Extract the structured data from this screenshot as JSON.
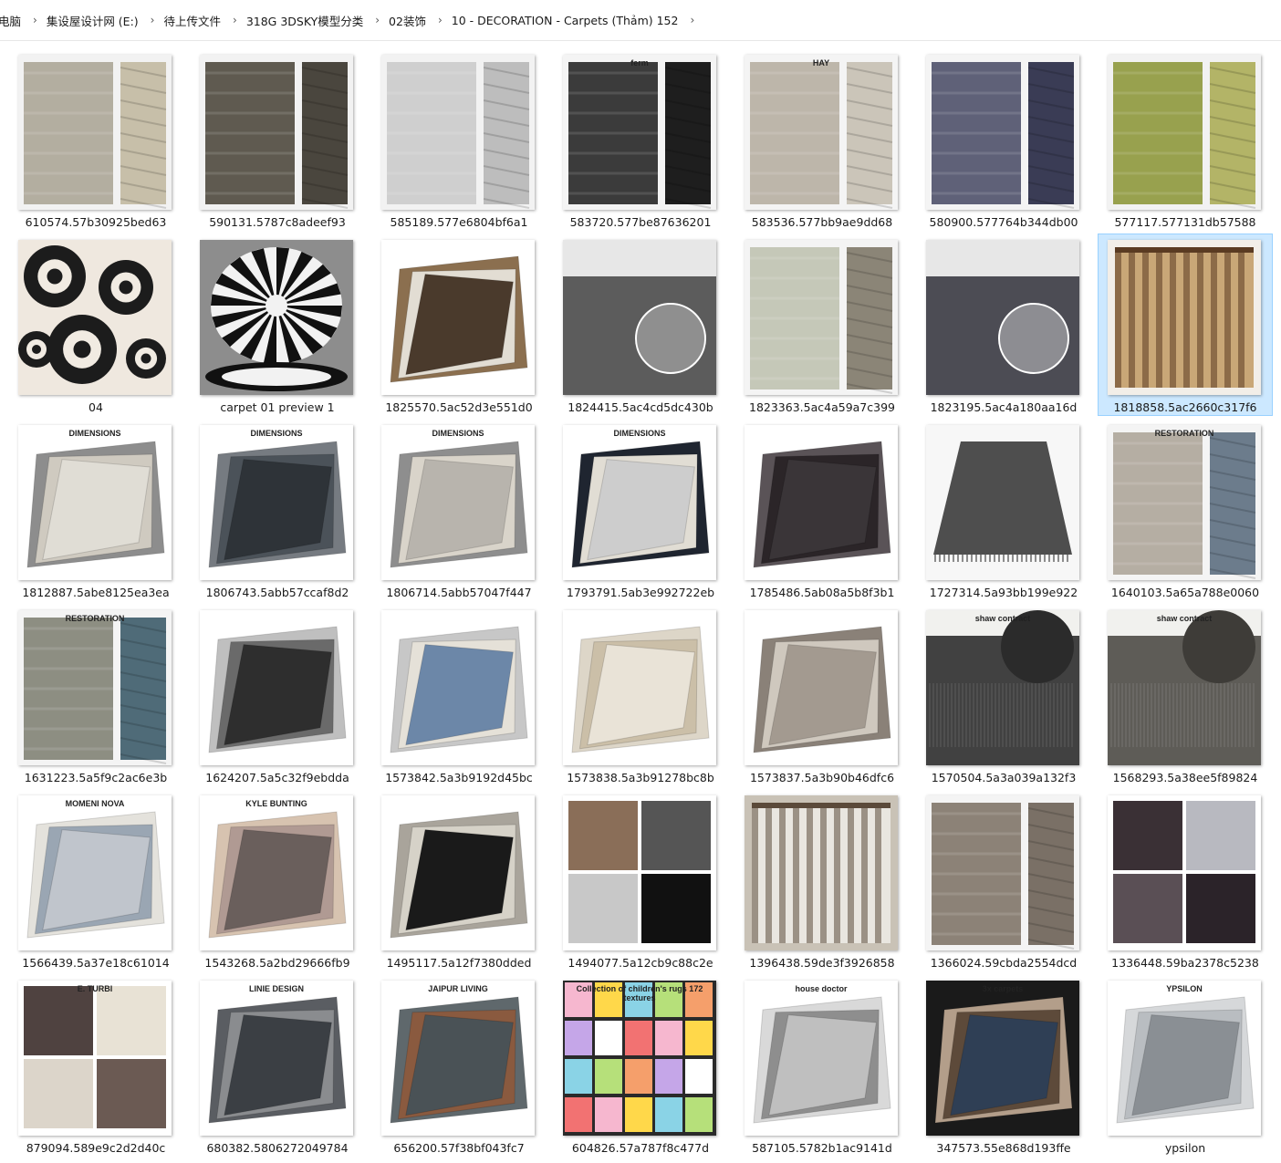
{
  "breadcrumb": [
    "电脑",
    "集设屋设计网 (E:)",
    "待上传文件",
    "318G 3DSKY模型分类",
    "02装饰",
    "10 - DECORATION - Carpets (Thảm) 152"
  ],
  "files": [
    {
      "name": "610574.57b30925bed63",
      "style": "runner-pair",
      "bg": "#f2f2f2",
      "c1": "#b3aea0",
      "c2": "#c7bfa9"
    },
    {
      "name": "590131.5787c8adeef93",
      "style": "runner-pair",
      "bg": "#f2f2f2",
      "c1": "#5f5a50",
      "c2": "#4a463e"
    },
    {
      "name": "585189.577e6804bf6a1",
      "style": "runner-pair",
      "bg": "#f2f2f2",
      "c1": "#cfcfcf",
      "c2": "#bdbdbd"
    },
    {
      "name": "583720.577be87636201",
      "style": "runner-pair",
      "bg": "#f4f4f4",
      "c1": "#3b3b3b",
      "c2": "#1e1e1e",
      "text": "ferm"
    },
    {
      "name": "583536.577bb9ae9dd68",
      "style": "runner-pair",
      "bg": "#f4f4f4",
      "c1": "#bdb6aa",
      "c2": "#cbc5b9",
      "text": "HAY"
    },
    {
      "name": "580900.577764b344db00",
      "style": "runner-pair",
      "bg": "#f4f4f4",
      "c1": "#5f6178",
      "c2": "#3a3c55"
    },
    {
      "name": "577117.577131db57588",
      "style": "runner-pair",
      "bg": "#f2f2f2",
      "c1": "#98a14e",
      "c2": "#b3b467"
    },
    {
      "name": "04",
      "style": "floral",
      "bg": "#efe8df",
      "c1": "#1c1c1c",
      "c2": "#f1ebe2"
    },
    {
      "name": "carpet 01 preview 1",
      "style": "round",
      "bg": "#8d8d8d",
      "c1": "#111111",
      "c2": "#f2f2f2"
    },
    {
      "name": "1825570.5ac52d3e551d0",
      "style": "stack",
      "bg": "#ffffff",
      "c1": "#4a3a2c",
      "c2": "#e2ddd3",
      "c3": "#8b6f4f"
    },
    {
      "name": "1824415.5ac4cd5dc430b",
      "style": "room",
      "bg": "#5c5c5c",
      "c1": "#8f8f8f",
      "c2": "#ffffff"
    },
    {
      "name": "1823363.5ac4a59a7c399",
      "style": "runner-pair",
      "bg": "#f4f4f4",
      "c1": "#c5c8b8",
      "c2": "#8b8577"
    },
    {
      "name": "1823195.5ac4a180aa16d",
      "style": "room",
      "bg": "#4c4c54",
      "c1": "#8d8d92",
      "c2": "#ffffff"
    },
    {
      "name": "1818858.5ac2660c317f6",
      "style": "curtain",
      "bg": "#f2eee8",
      "c1": "#5a3b22",
      "c2": "#c9a777",
      "selected": true
    },
    {
      "name": "1812887.5abe8125ea3ea",
      "style": "stack",
      "bg": "#ffffff",
      "c1": "#e0ddd5",
      "c2": "#cfcac0",
      "c3": "#8d8d8d",
      "text": "DIMENSIONS"
    },
    {
      "name": "1806743.5abb57ccaf8d2",
      "style": "stack",
      "bg": "#ffffff",
      "c1": "#2e3338",
      "c2": "#4b5259",
      "c3": "#767b81",
      "text": "DIMENSIONS"
    },
    {
      "name": "1806714.5abb57047f447",
      "style": "stack",
      "bg": "#ffffff",
      "c1": "#b8b4ad",
      "c2": "#d9d4ca",
      "c3": "#8e8e8e",
      "text": "DIMENSIONS"
    },
    {
      "name": "1793791.5ab3e992722eb",
      "style": "stack",
      "bg": "#ffffff",
      "c1": "#cdcdcd",
      "c2": "#e1ddd4",
      "c3": "#1f2530",
      "text": "DIMENSIONS"
    },
    {
      "name": "1785486.5ab08a5b8f3b1",
      "style": "stack",
      "bg": "#ffffff",
      "c1": "#3a3538",
      "c2": "#2b2528",
      "c3": "#5a5357"
    },
    {
      "name": "1727314.5a93bb199e922",
      "style": "single",
      "bg": "#f7f7f7",
      "c1": "#4e4e4e",
      "c2": "#8c8c8c"
    },
    {
      "name": "1640103.5a65a788e0060",
      "style": "runner-pair",
      "bg": "#f4f4f4",
      "c1": "#b5aea3",
      "c2": "#6c7c8c",
      "text": "RESTORATION"
    },
    {
      "name": "1631223.5a5f9c2ac6e3b",
      "style": "runner-pair",
      "bg": "#f4f4f4",
      "c1": "#8d8e82",
      "c2": "#4f6b78",
      "text": "RESTORATION"
    },
    {
      "name": "1624207.5a5c32f9ebdda",
      "style": "stack",
      "bg": "#ffffff",
      "c1": "#2e2e2e",
      "c2": "#6a6a6a",
      "c3": "#bfbfbf"
    },
    {
      "name": "1573842.5a3b9192d45bc",
      "style": "stack",
      "bg": "#ffffff",
      "c1": "#6c87a8",
      "c2": "#e5e1d8",
      "c3": "#c7c7c7"
    },
    {
      "name": "1573838.5a3b91278bc8b",
      "style": "stack",
      "bg": "#ffffff",
      "c1": "#e9e3d7",
      "c2": "#cbbfa8",
      "c3": "#ddd6c8"
    },
    {
      "name": "1573837.5a3b90b46dfc6",
      "style": "stack",
      "bg": "#ffffff",
      "c1": "#a39a90",
      "c2": "#cfc8be",
      "c3": "#8a8178"
    },
    {
      "name": "1570504.5a3a039a132f3",
      "style": "contract",
      "bg": "#414141",
      "c1": "#2b2b2b",
      "c2": "#ffffff",
      "text": "shaw contract"
    },
    {
      "name": "1568293.5a38ee5f89824",
      "style": "contract",
      "bg": "#5e5c57",
      "c1": "#3e3c38",
      "c2": "#ffffff",
      "text": "shaw contract"
    },
    {
      "name": "1566439.5a37e18c61014",
      "style": "stack",
      "bg": "#ffffff",
      "c1": "#c0c5cc",
      "c2": "#9aa6b3",
      "c3": "#e4e2dc",
      "text": "MOMENI NOVA"
    },
    {
      "name": "1543268.5a2bd29666fb9",
      "style": "stack",
      "bg": "#ffffff",
      "c1": "#6a5f5c",
      "c2": "#b09a93",
      "c3": "#d7c3b0",
      "text": "KYLE BUNTING"
    },
    {
      "name": "1495117.5a12f7380dded",
      "style": "stack",
      "bg": "#ffffff",
      "c1": "#1a1a1a",
      "c2": "#d6d2c8",
      "c3": "#a9a49b"
    },
    {
      "name": "1494077.5a12cb9c88c2e",
      "style": "quad",
      "bg": "#ffffff",
      "c1": "#8a6e58",
      "c2": "#555555",
      "c3": "#c8c8c8",
      "c4": "#111111"
    },
    {
      "name": "1396438.59de3f3926858",
      "style": "curtain",
      "bg": "#c9c2b6",
      "c1": "#5b4a3a",
      "c2": "#e9e6e0"
    },
    {
      "name": "1366024.59cbda2554dcd",
      "style": "runner-pair",
      "bg": "#f4f4f4",
      "c1": "#8c8277",
      "c2": "#7a7066"
    },
    {
      "name": "1336448.59ba2378c5238",
      "style": "quad",
      "bg": "#ffffff",
      "c1": "#3a3035",
      "c2": "#b8b9c0",
      "c3": "#5a4f55",
      "c4": "#2b2329"
    },
    {
      "name": "879094.589e9c2d2d40c",
      "style": "quad",
      "bg": "#ffffff",
      "c1": "#4f4240",
      "c2": "#e8e2d5",
      "c3": "#dcd5ca",
      "c4": "#6b5a53",
      "text": "E. TURBI"
    },
    {
      "name": "680382.5806272049784",
      "style": "stack",
      "bg": "#ffffff",
      "c1": "#3b3f44",
      "c2": "#8a8c8f",
      "c3": "#5a5d62",
      "text": "LINIE DESIGN"
    },
    {
      "name": "656200.57f38bf043fc7",
      "style": "stack",
      "bg": "#ffffff",
      "c1": "#4a5256",
      "c2": "#8a5a3f",
      "c3": "#5f686c",
      "text": "JAIPUR LIVING"
    },
    {
      "name": "604826.57a787f8c477d",
      "style": "kids",
      "bg": "#2a2a2a",
      "c1": "#f6b7cf",
      "c2": "#ffd84a",
      "text": "Collection of children's rugs 172 textures"
    },
    {
      "name": "587105.5782b1ac9141d",
      "style": "stack",
      "bg": "#ffffff",
      "c1": "#bfbfbf",
      "c2": "#8e8e8e",
      "c3": "#d9d9d9",
      "text": "house doctor"
    },
    {
      "name": "347573.55e868d193ffe",
      "style": "stack",
      "bg": "#1a1a1a",
      "c1": "#2f3f55",
      "c2": "#5d4a3a",
      "c3": "#b39e8a",
      "text": "3x carpets"
    },
    {
      "name": "ypsilon",
      "style": "stack",
      "bg": "#ffffff",
      "c1": "#8a8f94",
      "c2": "#b9bdc1",
      "c3": "#d6d8da",
      "text": "YPSILON"
    }
  ]
}
